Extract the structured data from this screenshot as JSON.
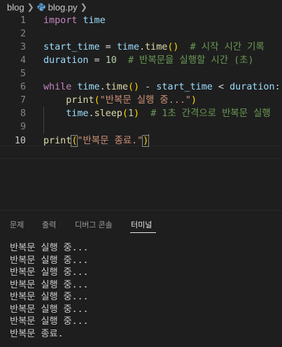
{
  "breadcrumb": {
    "folder": "blog",
    "file": "blog.py"
  },
  "editor": {
    "lines": [
      {
        "num": "1",
        "tokens": [
          [
            "kw",
            "import"
          ],
          [
            "op",
            " "
          ],
          [
            "var",
            "time"
          ]
        ]
      },
      {
        "num": "2",
        "tokens": []
      },
      {
        "num": "3",
        "tokens": [
          [
            "var",
            "start_time"
          ],
          [
            "op",
            " = "
          ],
          [
            "var",
            "time"
          ],
          [
            "op",
            "."
          ],
          [
            "fn",
            "time"
          ],
          [
            "br1",
            "()"
          ],
          [
            "op",
            "  "
          ],
          [
            "cm",
            "# 시작 시간 기록"
          ]
        ]
      },
      {
        "num": "4",
        "tokens": [
          [
            "var",
            "duration"
          ],
          [
            "op",
            " = "
          ],
          [
            "num",
            "10"
          ],
          [
            "op",
            "  "
          ],
          [
            "cm",
            "# 반복문을 실행할 시간 (초)"
          ]
        ]
      },
      {
        "num": "5",
        "tokens": []
      },
      {
        "num": "6",
        "tokens": [
          [
            "kw",
            "while"
          ],
          [
            "op",
            " "
          ],
          [
            "var",
            "time"
          ],
          [
            "op",
            "."
          ],
          [
            "fn",
            "time"
          ],
          [
            "br1",
            "()"
          ],
          [
            "op",
            " - "
          ],
          [
            "var",
            "start_time"
          ],
          [
            "op",
            " < "
          ],
          [
            "var",
            "duration"
          ],
          [
            "op",
            ":"
          ]
        ]
      },
      {
        "num": "7",
        "tokens": [
          [
            "op",
            "    "
          ],
          [
            "fn",
            "print"
          ],
          [
            "br1",
            "("
          ],
          [
            "str",
            "\"반복문 실행 중...\""
          ],
          [
            "br1",
            ")"
          ]
        ]
      },
      {
        "num": "8",
        "tokens": [
          [
            "op",
            "    "
          ],
          [
            "var",
            "time"
          ],
          [
            "op",
            "."
          ],
          [
            "fn",
            "sleep"
          ],
          [
            "br1",
            "("
          ],
          [
            "num",
            "1"
          ],
          [
            "br1",
            ")"
          ],
          [
            "op",
            "  "
          ],
          [
            "cm",
            "# 1초 간격으로 반복문 실행"
          ]
        ]
      },
      {
        "num": "9",
        "tokens": []
      },
      {
        "num": "10",
        "tokens": [
          [
            "fn",
            "print"
          ],
          [
            "br1box",
            "("
          ],
          [
            "str",
            "\"반복문 종료.\""
          ],
          [
            "br1box",
            ")"
          ]
        ]
      }
    ]
  },
  "panel": {
    "tabs": [
      "문제",
      "출력",
      "디버그 콘솔",
      "터미널"
    ],
    "active_tab": "터미널"
  },
  "terminal": {
    "lines": [
      "반복문 실행 중...",
      "반복문 실행 중...",
      "반복문 실행 중...",
      "반복문 실행 중...",
      "반복문 실행 중...",
      "반복문 실행 중...",
      "반복문 실행 중...",
      "반복문 종료."
    ]
  },
  "colors": {
    "background": "#1e1e1e",
    "keyword": "#c586c0",
    "variable": "#9cdcfe",
    "function": "#dcdcaa",
    "string": "#ce9178",
    "number": "#b5cea8",
    "comment": "#6a9955",
    "bracket": "#ffd700"
  }
}
